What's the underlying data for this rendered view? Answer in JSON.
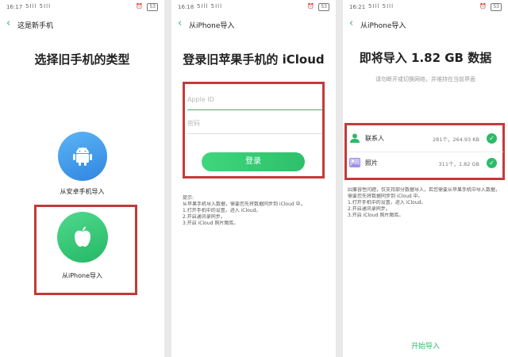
{
  "screens": [
    {
      "status": {
        "time": "16:17",
        "signal": "5Ill 5Ill",
        "battery": "53"
      },
      "nav_title": "这是新手机",
      "heading": "选择旧手机的类型",
      "options": [
        {
          "label": "从安卓手机导入",
          "icon": "android-icon"
        },
        {
          "label": "从iPhone导入",
          "icon": "apple-icon"
        }
      ]
    },
    {
      "status": {
        "time": "16:18",
        "signal": "5Ill 5Ill",
        "battery": "53"
      },
      "nav_title": "从iPhone导入",
      "heading": "登录旧苹果手机的 iCloud",
      "appleid_placeholder": "Apple ID",
      "password_placeholder": "密码",
      "login_label": "登录",
      "tips": [
        "提示:",
        "从苹果手机导入数据，需要您先将数据同步到 iCloud 中。",
        "1.打开手机中的设置，进入 iCloud。",
        "2.开启通讯录同步。",
        "3.开启 iCloud 照片图库。"
      ]
    },
    {
      "status": {
        "time": "16:21",
        "signal": "5Ill 5Ill",
        "battery": "53"
      },
      "nav_title": "从iPhone导入",
      "heading": "即将导入 1.82 GB 数据",
      "subheading": "请勿断开或切换网络，并维持在当前界面",
      "items": [
        {
          "label": "联系人",
          "meta": "281个，264.93 KB",
          "icon": "contacts-icon",
          "color": "#2eba6a"
        },
        {
          "label": "照片",
          "meta": "311个，1.82 GB",
          "icon": "photos-icon",
          "color": "#9b8fe8"
        }
      ],
      "tips": [
        "因兼容性问题，仅支持部分数据导入，若您需要从苹果手机中导入数据，",
        "需要您先将数据同步到 iCloud 中。",
        "1.打开手机中的设置，进入 iCloud。",
        "2.开启通讯录同步。",
        "3.开启 iCloud 照片图库。"
      ],
      "start_label": "开始导入"
    }
  ],
  "colors": {
    "accent": "#2eba6a",
    "highlight": "#c23b3b",
    "android_blue": "#3a92e8"
  }
}
